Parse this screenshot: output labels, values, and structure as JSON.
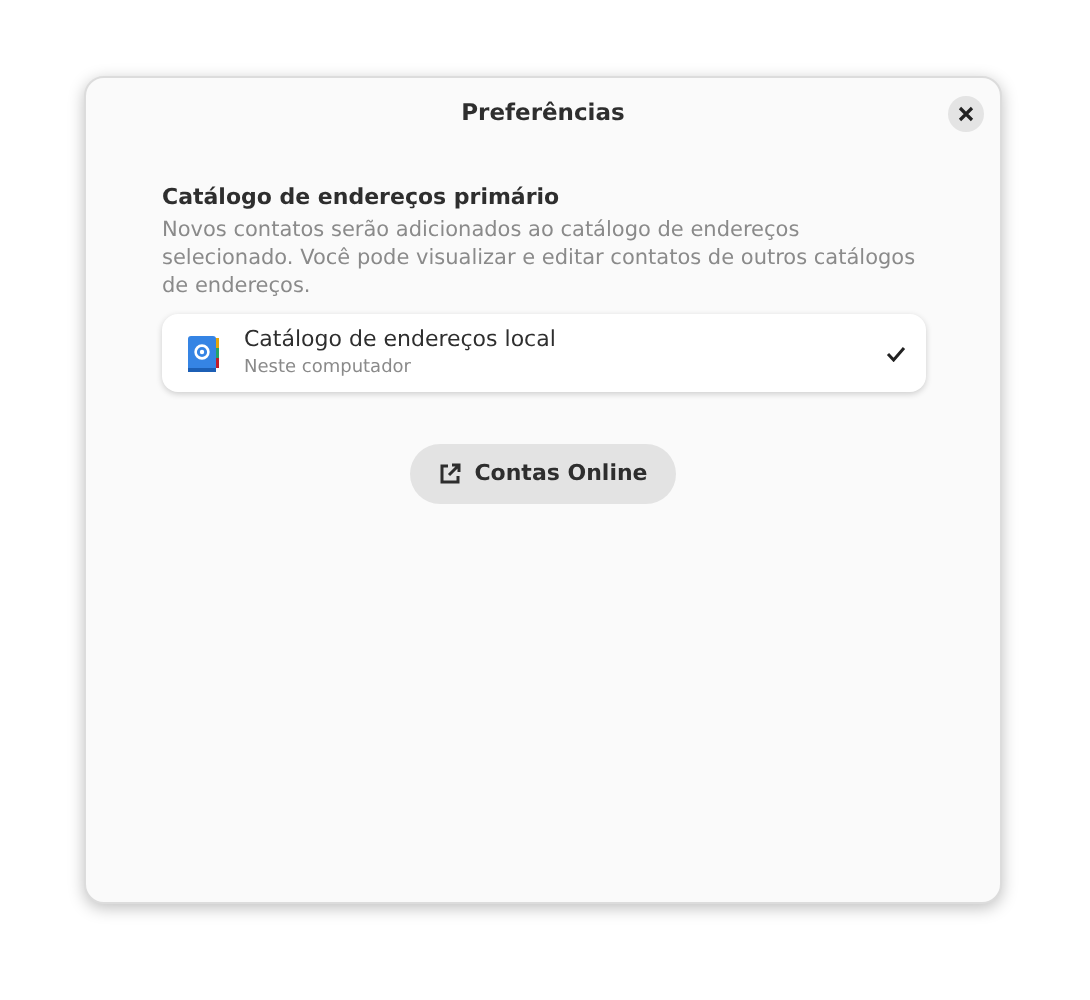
{
  "window": {
    "title": "Preferências"
  },
  "section": {
    "heading": "Catálogo de endereços primário",
    "description": "Novos contatos serão adicionados ao catálogo de endereços selecionado. Você pode visualizar e editar contatos de outros catálogos de endereços."
  },
  "address_books": [
    {
      "name": "Catálogo de endereços local",
      "subtitle": "Neste computador",
      "selected": true
    }
  ],
  "online_accounts_button": {
    "label": "Contas Online"
  }
}
